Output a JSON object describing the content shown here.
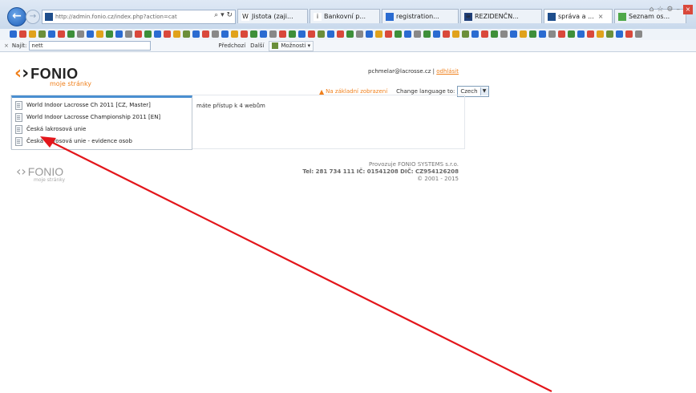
{
  "browser": {
    "url": "http://admin.fonio.cz/index.php?action=cat",
    "address_tools": "⌕ ▾ ↻",
    "tabs": [
      {
        "label": "Jistota (zaji...",
        "icon_color": "#ffffff",
        "icon_text": "W"
      },
      {
        "label": "Bankovní p...",
        "icon_color": "#ffffff",
        "icon_text": "i"
      },
      {
        "label": "registration...",
        "icon_color": "#2a6bd1",
        "icon_text": ""
      },
      {
        "label": "REZIDENČN...",
        "icon_color": "#1f3f7a",
        "icon_text": "≋"
      },
      {
        "label": "správa a ...",
        "icon_color": "#1f4e8c",
        "icon_text": "",
        "active": true,
        "close": "×"
      },
      {
        "label": "Seznam os...",
        "icon_color": "#4fa84a",
        "icon_text": ""
      }
    ],
    "window_controls": {
      "home": "⌂",
      "star": "☆",
      "settings": "⚙",
      "minimize": "–",
      "close": "×"
    },
    "back_glyph": "←",
    "forward_glyph": "→"
  },
  "findbar": {
    "close": "×",
    "label": "Najít:",
    "value": "nett",
    "previous": "Předchozí",
    "next": "Další",
    "options": "Možnosti ▾"
  },
  "page": {
    "logo": {
      "mark": "‹›",
      "name": "FONIO",
      "subtitle": "moje stránky"
    },
    "user_email": "pchmelar@lacrosse.cz",
    "separator": " | ",
    "logout": "odhlásit",
    "basic_view": "Na základní zobrazení",
    "change_language_label": "Change language to:",
    "language_value": "Czech",
    "select_arrow": "▼",
    "sites": [
      "World Indoor Lacrosse Ch 2011 [CZ, Master]",
      "World Indoor Lacrosse Championship 2011 [EN]",
      "Česká lakrosová unie",
      "Česká lakrosová unie - evidence osob"
    ],
    "access_text": "máte přístup k 4 webům",
    "footer": {
      "logo_name": "FONIO",
      "logo_sub": "moje stránky",
      "operator": "Provozuje FONIO SYSTEMS s.r.o.",
      "contact": "Tel: 281 734 111 IČ: 01541208 DIČ: CZ954126208",
      "copyright": "© 2001 - 2015"
    }
  },
  "annotation": {
    "color": "#e3161b"
  }
}
